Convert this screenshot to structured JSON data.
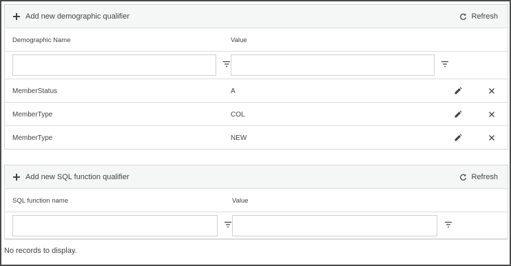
{
  "demographic": {
    "add_label": "Add new demographic qualifier",
    "refresh_label": "Refresh",
    "columns": [
      "Demographic Name",
      "Value"
    ],
    "filters": {
      "name_value": "",
      "value_value": ""
    },
    "rows": [
      {
        "name": "MemberStatus",
        "value": "A"
      },
      {
        "name": "MemberType",
        "value": "COL"
      },
      {
        "name": "MemberType",
        "value": "NEW"
      }
    ]
  },
  "sql_function": {
    "add_label": "Add new SQL function qualifier",
    "refresh_label": "Refresh",
    "columns": [
      "SQL function name",
      "Value"
    ],
    "filters": {
      "name_value": "",
      "value_value": ""
    },
    "empty_text": "No records to display."
  },
  "icons": {
    "add": "plus-icon",
    "refresh": "refresh-icon",
    "filter": "filter-icon",
    "edit": "pencil-icon",
    "delete": "close-icon"
  },
  "colors": {
    "toolbar_bg": "#f5f7f7",
    "border": "#dedede",
    "text": "#424242"
  }
}
